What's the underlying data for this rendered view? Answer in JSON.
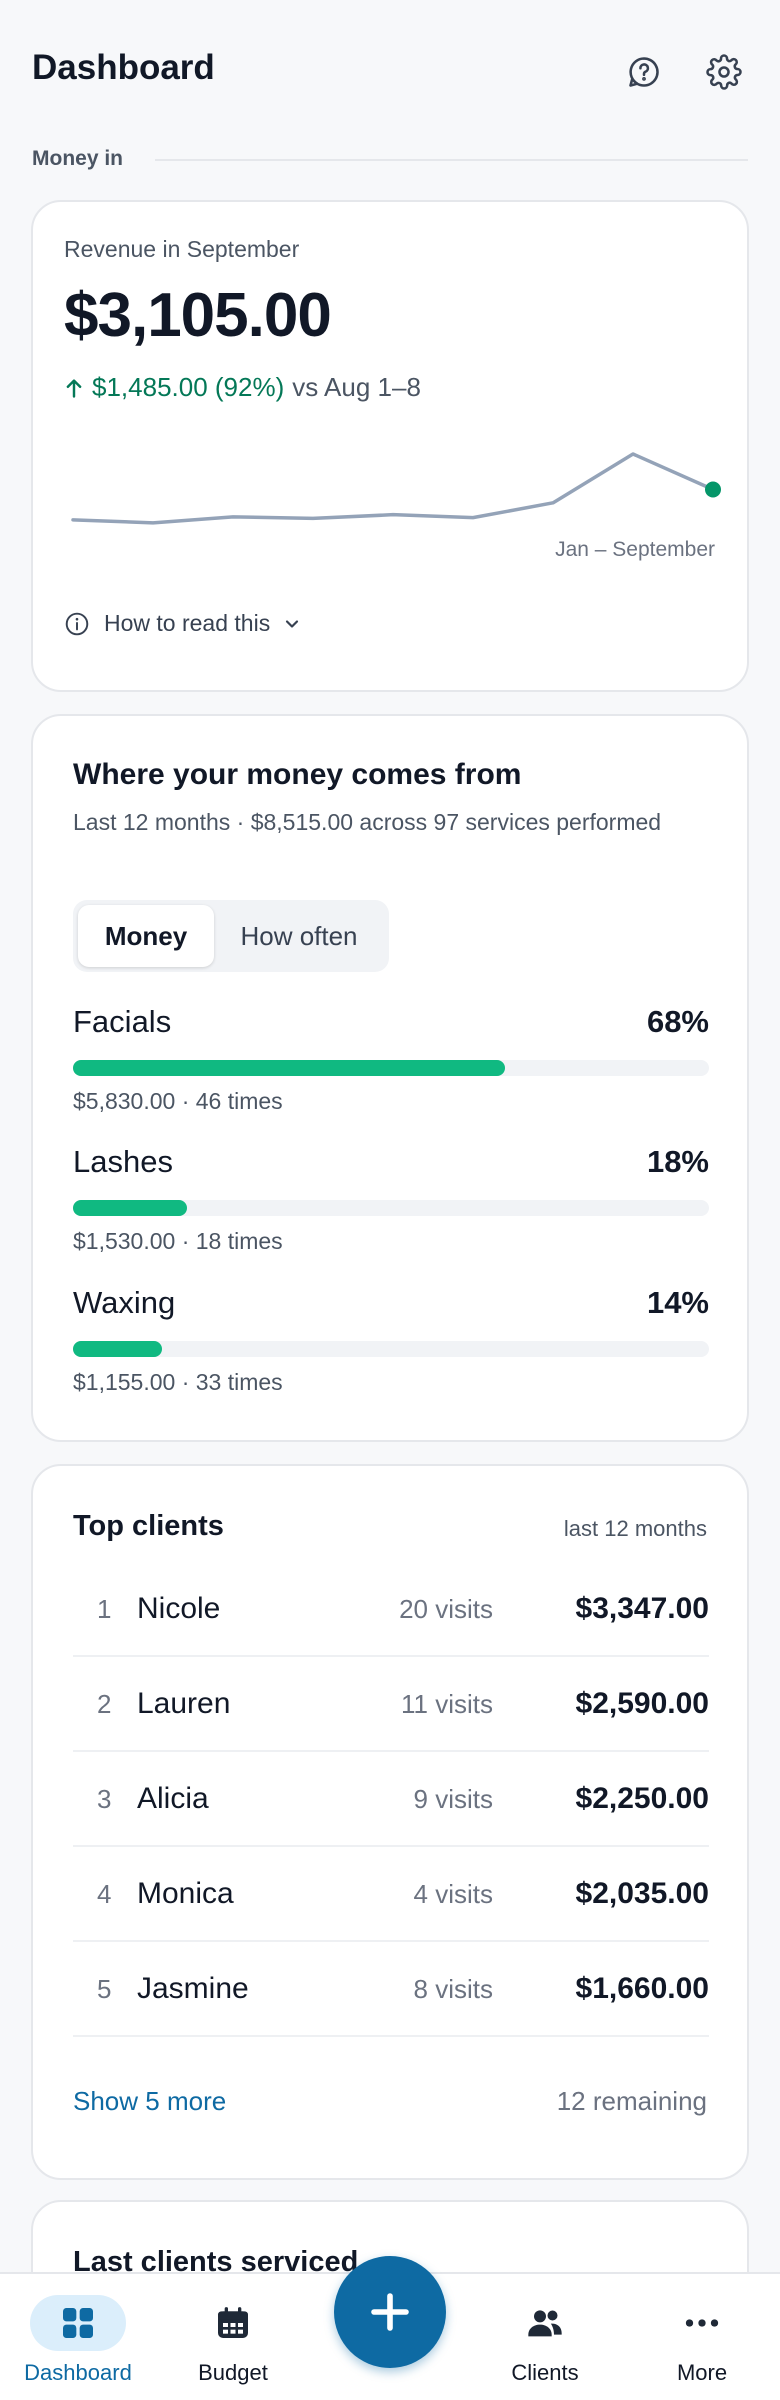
{
  "header": {
    "title": "Dashboard",
    "help_icon": "help-circle-icon",
    "settings_icon": "gear-icon"
  },
  "section_money_in": "Money in",
  "revenue": {
    "label": "Revenue in September",
    "value": "$3,105.00",
    "delta": "$1,485.00 (92%)",
    "delta_compare": "vs Aug 1–8",
    "range_label": "Jan – September",
    "how_to_read": "How to read this",
    "accent_color": "#047857",
    "sparkline_trend": [
      0.11,
      0.07,
      0.15,
      0.13,
      0.18,
      0.14,
      0.34,
      1.0,
      0.52
    ]
  },
  "sources": {
    "title": "Where your money comes from",
    "subtitle": "Last 12 months · $8,515.00 across 97 services performed",
    "toggle": [
      "Money",
      "How often"
    ],
    "toggle_selected": "Money",
    "items": [
      {
        "name": "Facials",
        "pct_label": "68%",
        "pct": 68,
        "meta": "$5,830.00 · 46 times"
      },
      {
        "name": "Lashes",
        "pct_label": "18%",
        "pct": 18,
        "meta": "$1,530.00 · 18 times"
      },
      {
        "name": "Waxing",
        "pct_label": "14%",
        "pct": 14,
        "meta": "$1,155.00 · 33 times"
      }
    ],
    "bar_color": "#10b981"
  },
  "top_clients": {
    "title": "Top clients",
    "period": "last 12 months",
    "rows": [
      {
        "rank": "1",
        "name": "Nicole",
        "visits": "20 visits",
        "amount": "$3,347.00"
      },
      {
        "rank": "2",
        "name": "Lauren",
        "visits": "11 visits",
        "amount": "$2,590.00"
      },
      {
        "rank": "3",
        "name": "Alicia",
        "visits": "9 visits",
        "amount": "$2,250.00"
      },
      {
        "rank": "4",
        "name": "Monica",
        "visits": "4 visits",
        "amount": "$2,035.00"
      },
      {
        "rank": "5",
        "name": "Jasmine",
        "visits": "8 visits",
        "amount": "$1,660.00"
      }
    ],
    "show_more": "Show 5 more",
    "remaining": "12 remaining"
  },
  "last_clients": {
    "title": "Last clients serviced"
  },
  "nav": {
    "items": [
      {
        "label": "Dashboard",
        "icon": "dashboard-grid-icon",
        "active": true
      },
      {
        "label": "Budget",
        "icon": "calendar-icon",
        "active": false
      },
      {
        "label": "Clients",
        "icon": "users-icon",
        "active": false
      },
      {
        "label": "More",
        "icon": "more-dots-icon",
        "active": false
      }
    ],
    "fab_icon": "plus-icon",
    "brand_color": "#0e6aa3"
  }
}
